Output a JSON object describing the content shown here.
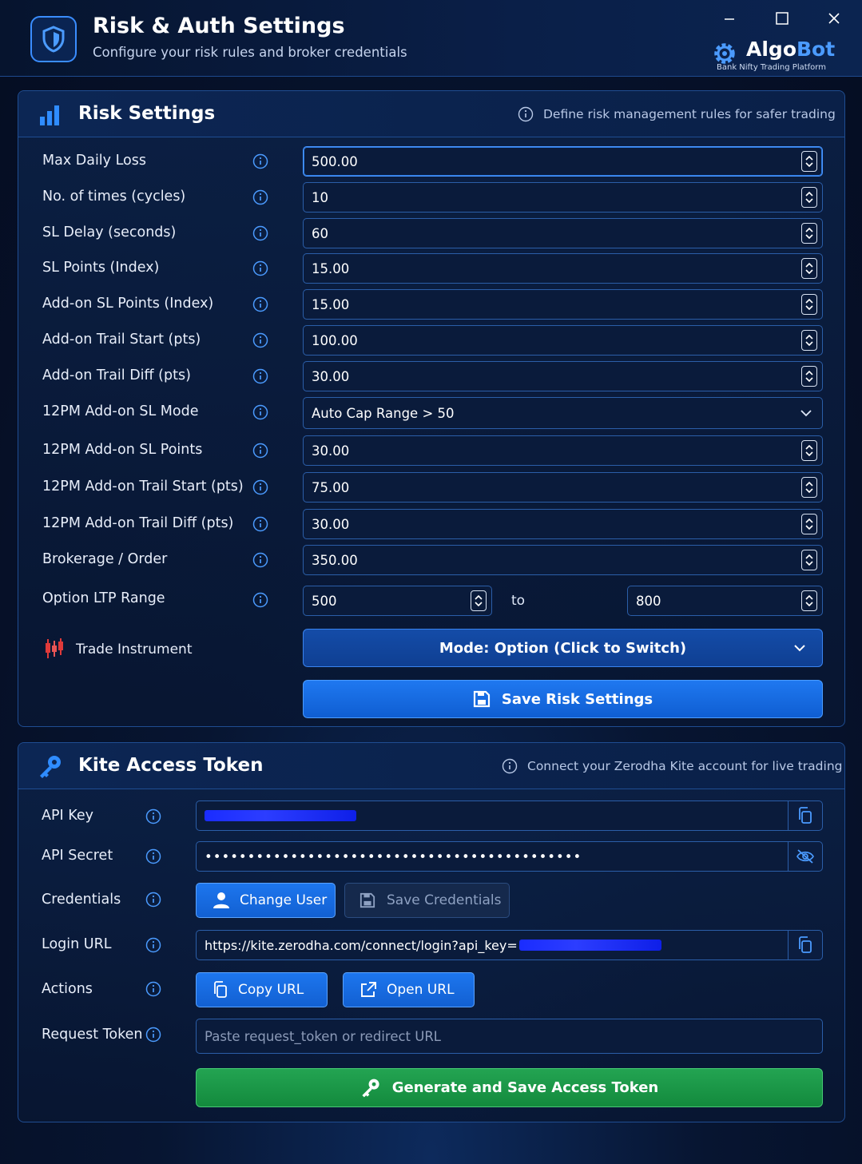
{
  "window": {
    "title": "Risk & Auth Settings",
    "subtitle": "Configure your risk rules and broker credentials",
    "brand_main": "Algo",
    "brand_accent": "Bot",
    "brand_tagline": "Bank Nifty Trading Platform"
  },
  "risk": {
    "title": "Risk Settings",
    "hint": "Define risk management rules for safer trading",
    "rows": [
      {
        "label": "Max Daily Loss",
        "value": "500.00"
      },
      {
        "label": "No. of times (cycles)",
        "value": "10"
      },
      {
        "label": "SL Delay (seconds)",
        "value": "60"
      },
      {
        "label": "SL Points (Index)",
        "value": "15.00"
      },
      {
        "label": "Add-on SL Points (Index)",
        "value": "15.00"
      },
      {
        "label": "Add-on Trail Start (pts)",
        "value": "100.00"
      },
      {
        "label": "Add-on Trail Diff (pts)",
        "value": "30.00"
      },
      {
        "label": "12PM Add-on SL Mode",
        "value": "Auto Cap Range > 50"
      },
      {
        "label": "12PM Add-on SL Points",
        "value": "30.00"
      },
      {
        "label": "12PM Add-on Trail Start (pts)",
        "value": "75.00"
      },
      {
        "label": "12PM Add-on Trail Diff (pts)",
        "value": "30.00"
      },
      {
        "label": "Brokerage / Order",
        "value": "350.00"
      }
    ],
    "ltp": {
      "label": "Option LTP Range",
      "from": "500",
      "sep": "to",
      "to": "800"
    },
    "instrument": {
      "label": "Trade Instrument",
      "mode_button": "Mode: Option (Click to Switch)"
    },
    "save_button": "Save Risk Settings"
  },
  "kite": {
    "title": "Kite Access Token",
    "hint": "Connect your Zerodha Kite account for live trading",
    "api_key_label": "API Key",
    "api_secret_label": "API Secret",
    "api_secret_value": "••••••••••••••••••••••••••••••••••••••••••••",
    "credentials_label": "Credentials",
    "change_user": "Change User",
    "save_credentials": "Save Credentials",
    "login_url_label": "Login URL",
    "login_url_value": "https://kite.zerodha.com/connect/login?api_key=",
    "actions_label": "Actions",
    "copy_url": "Copy URL",
    "open_url": "Open URL",
    "request_token_label": "Request Token",
    "request_token_placeholder": "Paste request_token or redirect URL",
    "generate_button": "Generate and Save Access Token"
  },
  "colors": {
    "accent": "#1f78f0",
    "success": "#23a452",
    "background": "#071531"
  }
}
